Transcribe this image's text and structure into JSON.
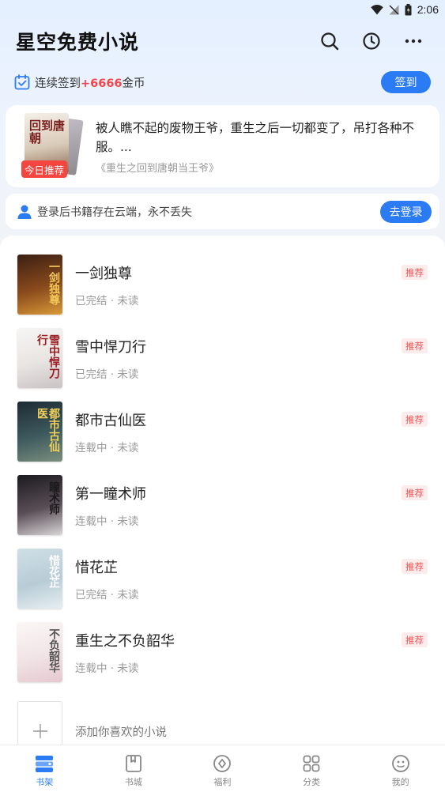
{
  "status_bar": {
    "time": "2:06"
  },
  "header": {
    "title": "星空免费小说",
    "icons": [
      "search-icon",
      "history-icon",
      "more-icon"
    ]
  },
  "checkin": {
    "prefix": "连续签到",
    "highlight": "+6666",
    "suffix": "金币",
    "button_label": "签到"
  },
  "recommendation": {
    "badge": "今日推荐",
    "description": "被人瞧不起的废物王爷，重生之后一切都变了，吊打各种不服。...",
    "source": "《重生之回到唐朝当王爷》",
    "cover_text": "回到唐朝"
  },
  "login_prompt": {
    "text": "登录后书籍存在云端，永不丢失",
    "button_label": "去登录"
  },
  "books": [
    {
      "title": "一剑独尊",
      "status": "已完结 · 未读",
      "tag": "推荐",
      "cover_text": "一剑独尊",
      "cover_colors": [
        "#3a1f14",
        "#8a4a1c",
        "#d89a3a"
      ],
      "cover_text_color": "#f3c95a"
    },
    {
      "title": "雪中悍刀行",
      "status": "已完结 · 未读",
      "tag": "推荐",
      "cover_text": "雪中悍刀行",
      "cover_colors": [
        "#f7f6f4",
        "#e8e4e2",
        "#c9c3c3"
      ],
      "cover_text_color": "#9b1e24"
    },
    {
      "title": "都市古仙医",
      "status": "连载中 · 未读",
      "tag": "推荐",
      "cover_text": "都市古仙医",
      "cover_colors": [
        "#1d2a33",
        "#3e5a5e",
        "#7a8f7e"
      ],
      "cover_text_color": "#f2d25a"
    },
    {
      "title": "第一瞳术师",
      "status": "连载中 · 未读",
      "tag": "推荐",
      "cover_text": "瞳术师",
      "cover_colors": [
        "#1a1a1e",
        "#5a4e56",
        "#d9d6d8"
      ],
      "cover_text_color": "#1a1a1a"
    },
    {
      "title": "惜花芷",
      "status": "已完结 · 未读",
      "tag": "推荐",
      "cover_text": "惜花芷",
      "cover_colors": [
        "#cfdfe6",
        "#b8ccd6",
        "#e7eef1"
      ],
      "cover_text_color": "#ffffff"
    },
    {
      "title": "重生之不负韶华",
      "status": "连载中 · 未读",
      "tag": "推荐",
      "cover_text": "不负韶华",
      "cover_colors": [
        "#fbf7f6",
        "#f1e4e6",
        "#e5c9cf"
      ],
      "cover_text_color": "#555555"
    }
  ],
  "add_book": {
    "text": "添加你喜欢的小说"
  },
  "tabs": [
    {
      "label": "书架",
      "icon": "bookshelf-icon",
      "active": true
    },
    {
      "label": "书城",
      "icon": "bookstore-icon",
      "active": false
    },
    {
      "label": "福利",
      "icon": "welfare-icon",
      "active": false
    },
    {
      "label": "分类",
      "icon": "category-icon",
      "active": false
    },
    {
      "label": "我的",
      "icon": "profile-icon",
      "active": false
    }
  ],
  "colors": {
    "accent": "#2b7cf4",
    "highlight_red": "#f2464a",
    "tag_bg": "#fdecec"
  }
}
